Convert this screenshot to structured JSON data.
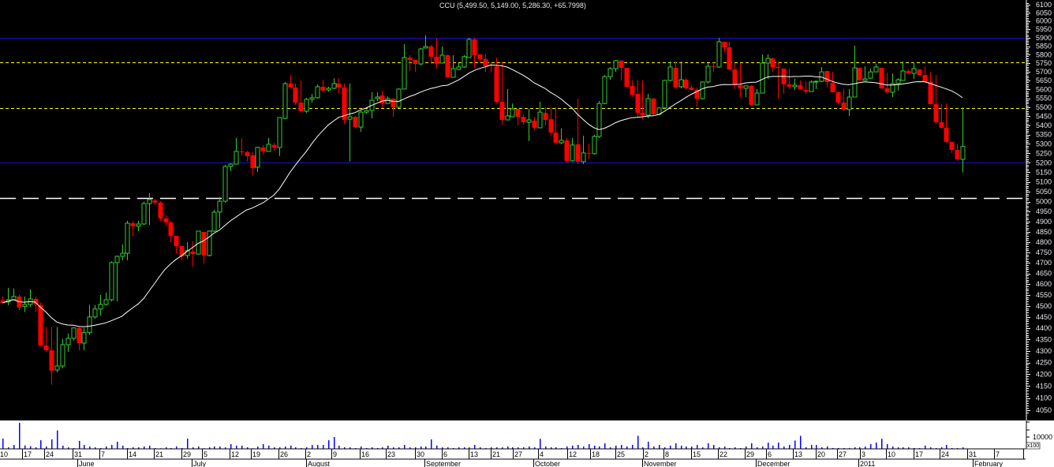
{
  "chart_data": {
    "type": "candlestick",
    "title": "CCU (5,499.50, 5,149.00, 5,286.30, +65.7998)",
    "symbol": "CCU",
    "y_scale": "log",
    "ylim": [
      4030,
      6120
    ],
    "y_ticks": [
      4050,
      4100,
      4150,
      4200,
      4250,
      4300,
      4350,
      4400,
      4450,
      4500,
      4550,
      4600,
      4650,
      4700,
      4750,
      4800,
      4850,
      4900,
      4950,
      5000,
      5050,
      5100,
      5150,
      5200,
      5250,
      5300,
      5350,
      5400,
      5450,
      5500,
      5550,
      5600,
      5650,
      5700,
      5750,
      5800,
      5850,
      5900,
      5950,
      6000,
      6050,
      6100
    ],
    "moving_average": {
      "period": 20,
      "color": "#ffffff"
    },
    "colors": {
      "up": "#33cc33",
      "down": "#ff0000",
      "background": "#000000",
      "volume": "#0000ff",
      "support": "#0000cc",
      "trigger": "#ffff00"
    },
    "horizontal_lines": [
      {
        "value": 5900,
        "style": "solid",
        "color": "#1414c8"
      },
      {
        "value": 5755,
        "style": "dashed",
        "color": "#ffff00"
      },
      {
        "value": 5495,
        "style": "dashed",
        "color": "#ffff00"
      },
      {
        "value": 5200,
        "style": "solid",
        "color": "#1414c8"
      },
      {
        "value": 5020,
        "style": "longdash",
        "color": "#ffffff"
      }
    ],
    "ohlc": [
      [
        4525,
        4543,
        4510,
        4514
      ],
      [
        4518,
        4583,
        4503,
        4528
      ],
      [
        4528,
        4580,
        4525,
        4543
      ],
      [
        4543,
        4550,
        4482,
        4493
      ],
      [
        4497,
        4543,
        4472,
        4507
      ],
      [
        4507,
        4576,
        4496,
        4532
      ],
      [
        4532,
        4543,
        4472,
        4507
      ],
      [
        4504,
        4515,
        4320,
        4324
      ],
      [
        4324,
        4405,
        4296,
        4303
      ],
      [
        4303,
        4405,
        4156,
        4215
      ],
      [
        4218,
        4405,
        4208,
        4235
      ],
      [
        4235,
        4352,
        4225,
        4327
      ],
      [
        4327,
        4376,
        4296,
        4355
      ],
      [
        4355,
        4405,
        4345,
        4401
      ],
      [
        4401,
        4405,
        4303,
        4334
      ],
      [
        4334,
        4401,
        4303,
        4380
      ],
      [
        4380,
        4504,
        4370,
        4450
      ],
      [
        4450,
        4504,
        4443,
        4486
      ],
      [
        4486,
        4550,
        4457,
        4507
      ],
      [
        4507,
        4561,
        4500,
        4528
      ],
      [
        4528,
        4708,
        4521,
        4701
      ],
      [
        4701,
        4735,
        4521,
        4731
      ],
      [
        4731,
        4788,
        4712,
        4746
      ],
      [
        4746,
        4904,
        4712,
        4892
      ],
      [
        4892,
        4904,
        4830,
        4877
      ],
      [
        4877,
        4904,
        4853,
        4888
      ],
      [
        4888,
        5000,
        4884,
        4990
      ],
      [
        4990,
        5043,
        4884,
        5010
      ],
      [
        5006,
        5010,
        4983,
        4995
      ],
      [
        4995,
        5002,
        4904,
        4916
      ],
      [
        4916,
        4932,
        4880,
        4896
      ],
      [
        4896,
        4904,
        4799,
        4830
      ],
      [
        4830,
        4830,
        4746,
        4780
      ],
      [
        4780,
        4780,
        4712,
        4731
      ],
      [
        4735,
        4799,
        4720,
        4758
      ],
      [
        4754,
        4803,
        4682,
        4742
      ],
      [
        4742,
        4853,
        4739,
        4853
      ],
      [
        4849,
        4849,
        4697,
        4735
      ],
      [
        4735,
        4857,
        4731,
        4853
      ],
      [
        4853,
        4959,
        4849,
        4947
      ],
      [
        4947,
        5022,
        4869,
        5002
      ],
      [
        5002,
        5189,
        4995,
        5181
      ],
      [
        5181,
        5197,
        5156,
        5193
      ],
      [
        5193,
        5332,
        5193,
        5260
      ],
      [
        5260,
        5332,
        5239,
        5256
      ],
      [
        5256,
        5264,
        5206,
        5235
      ],
      [
        5239,
        5256,
        5135,
        5172
      ],
      [
        5177,
        5285,
        5152,
        5281
      ],
      [
        5281,
        5294,
        5243,
        5260
      ],
      [
        5260,
        5332,
        5260,
        5298
      ],
      [
        5294,
        5306,
        5264,
        5281
      ],
      [
        5281,
        5443,
        5235,
        5443
      ],
      [
        5438,
        5642,
        5434,
        5633
      ],
      [
        5633,
        5682,
        5606,
        5611
      ],
      [
        5611,
        5633,
        5513,
        5526
      ],
      [
        5526,
        5651,
        5469,
        5478
      ],
      [
        5478,
        5553,
        5469,
        5544
      ],
      [
        5544,
        5575,
        5526,
        5553
      ],
      [
        5553,
        5628,
        5548,
        5615
      ],
      [
        5615,
        5655,
        5584,
        5593
      ],
      [
        5597,
        5615,
        5588,
        5606
      ],
      [
        5606,
        5664,
        5602,
        5633
      ],
      [
        5633,
        5664,
        5579,
        5611
      ],
      [
        5611,
        5633,
        5408,
        5430
      ],
      [
        5434,
        5633,
        5206,
        5447
      ],
      [
        5447,
        5452,
        5383,
        5391
      ],
      [
        5391,
        5482,
        5365,
        5473
      ],
      [
        5473,
        5487,
        5465,
        5482
      ],
      [
        5482,
        5584,
        5439,
        5539
      ],
      [
        5548,
        5584,
        5535,
        5557
      ],
      [
        5566,
        5593,
        5496,
        5521
      ],
      [
        5521,
        5561,
        5521,
        5548
      ],
      [
        5548,
        5548,
        5447,
        5500
      ],
      [
        5500,
        5606,
        5496,
        5602
      ],
      [
        5602,
        5862,
        5602,
        5783
      ],
      [
        5783,
        5797,
        5705,
        5769
      ],
      [
        5769,
        5769,
        5700,
        5746
      ],
      [
        5746,
        5839,
        5737,
        5834
      ],
      [
        5839,
        5914,
        5839,
        5848
      ],
      [
        5848,
        5858,
        5746,
        5788
      ],
      [
        5788,
        5895,
        5719,
        5746
      ],
      [
        5751,
        5848,
        5751,
        5797
      ],
      [
        5797,
        5802,
        5664,
        5669
      ],
      [
        5669,
        5797,
        5669,
        5719
      ],
      [
        5714,
        5751,
        5710,
        5728
      ],
      [
        5728,
        5797,
        5723,
        5788
      ],
      [
        5783,
        5900,
        5783,
        5890
      ],
      [
        5890,
        5900,
        5723,
        5797
      ],
      [
        5802,
        5802,
        5751,
        5774
      ],
      [
        5774,
        5802,
        5700,
        5732
      ],
      [
        5741,
        5751,
        5700,
        5737
      ],
      [
        5732,
        5783,
        5521,
        5530
      ],
      [
        5530,
        5760,
        5404,
        5430
      ],
      [
        5430,
        5602,
        5430,
        5452
      ],
      [
        5447,
        5521,
        5447,
        5491
      ],
      [
        5491,
        5491,
        5400,
        5447
      ],
      [
        5447,
        5460,
        5404,
        5417
      ],
      [
        5417,
        5491,
        5315,
        5430
      ],
      [
        5426,
        5447,
        5374,
        5387
      ],
      [
        5387,
        5530,
        5387,
        5473
      ],
      [
        5469,
        5500,
        5400,
        5430
      ],
      [
        5434,
        5500,
        5344,
        5361
      ],
      [
        5361,
        5500,
        5306,
        5306
      ],
      [
        5306,
        5383,
        5298,
        5319
      ],
      [
        5319,
        5332,
        5202,
        5210
      ],
      [
        5210,
        5332,
        5206,
        5294
      ],
      [
        5298,
        5548,
        5193,
        5206
      ],
      [
        5206,
        5344,
        5193,
        5252
      ],
      [
        5252,
        5302,
        5218,
        5248
      ],
      [
        5248,
        5349,
        5243,
        5340
      ],
      [
        5340,
        5535,
        5332,
        5521
      ],
      [
        5521,
        5682,
        5517,
        5673
      ],
      [
        5673,
        5728,
        5655,
        5719
      ],
      [
        5719,
        5769,
        5700,
        5765
      ],
      [
        5765,
        5769,
        5651,
        5723
      ],
      [
        5723,
        5723,
        5611,
        5615
      ],
      [
        5620,
        5651,
        5557,
        5570
      ],
      [
        5575,
        5651,
        5447,
        5469
      ],
      [
        5469,
        5651,
        5434,
        5456
      ],
      [
        5456,
        5575,
        5439,
        5548
      ],
      [
        5548,
        5553,
        5456,
        5460
      ],
      [
        5460,
        5500,
        5456,
        5496
      ],
      [
        5496,
        5655,
        5496,
        5651
      ],
      [
        5651,
        5760,
        5646,
        5728
      ],
      [
        5723,
        5760,
        5602,
        5611
      ],
      [
        5615,
        5760,
        5606,
        5655
      ],
      [
        5655,
        5664,
        5597,
        5606
      ],
      [
        5611,
        5624,
        5593,
        5597
      ],
      [
        5597,
        5611,
        5504,
        5548
      ],
      [
        5548,
        5646,
        5544,
        5642
      ],
      [
        5642,
        5751,
        5633,
        5732
      ],
      [
        5732,
        5755,
        5700,
        5728
      ],
      [
        5728,
        5900,
        5723,
        5876
      ],
      [
        5876,
        5876,
        5815,
        5843
      ],
      [
        5843,
        5876,
        5710,
        5714
      ],
      [
        5714,
        5751,
        5602,
        5624
      ],
      [
        5624,
        5751,
        5557,
        5606
      ],
      [
        5606,
        5620,
        5557,
        5620
      ],
      [
        5620,
        5624,
        5509,
        5513
      ],
      [
        5513,
        5602,
        5513,
        5579
      ],
      [
        5579,
        5802,
        5579,
        5751
      ],
      [
        5751,
        5802,
        5660,
        5778
      ],
      [
        5778,
        5783,
        5700,
        5728
      ],
      [
        5728,
        5760,
        5548,
        5723
      ],
      [
        5719,
        5719,
        5575,
        5629
      ],
      [
        5629,
        5719,
        5602,
        5615
      ],
      [
        5615,
        5660,
        5597,
        5624
      ],
      [
        5624,
        5651,
        5602,
        5602
      ],
      [
        5597,
        5646,
        5575,
        5588
      ],
      [
        5588,
        5651,
        5588,
        5642
      ],
      [
        5642,
        5651,
        5602,
        5646
      ],
      [
        5646,
        5728,
        5642,
        5700
      ],
      [
        5705,
        5705,
        5611,
        5642
      ],
      [
        5637,
        5700,
        5584,
        5584
      ],
      [
        5584,
        5584,
        5517,
        5526
      ],
      [
        5526,
        5602,
        5478,
        5487
      ],
      [
        5487,
        5602,
        5452,
        5557
      ],
      [
        5557,
        5853,
        5557,
        5723
      ],
      [
        5723,
        5723,
        5651,
        5651
      ],
      [
        5651,
        5732,
        5651,
        5660
      ],
      [
        5664,
        5719,
        5660,
        5700
      ],
      [
        5700,
        5746,
        5700,
        5728
      ],
      [
        5723,
        5723,
        5602,
        5606
      ],
      [
        5606,
        5696,
        5575,
        5584
      ],
      [
        5584,
        5691,
        5557,
        5633
      ],
      [
        5633,
        5664,
        5593,
        5655
      ],
      [
        5651,
        5760,
        5651,
        5705
      ],
      [
        5705,
        5714,
        5691,
        5691
      ],
      [
        5691,
        5755,
        5660,
        5719
      ],
      [
        5714,
        5714,
        5682,
        5682
      ],
      [
        5682,
        5732,
        5642,
        5642
      ],
      [
        5642,
        5700,
        5517,
        5517
      ],
      [
        5517,
        5682,
        5408,
        5417
      ],
      [
        5417,
        5517,
        5383,
        5387
      ],
      [
        5387,
        5521,
        5306,
        5311
      ],
      [
        5311,
        5311,
        5252,
        5268
      ],
      [
        5268,
        5302,
        5210,
        5218
      ],
      [
        5218,
        5499.5,
        5149,
        5286.3
      ]
    ],
    "volume": [
      8700,
      1300,
      3300,
      22000,
      2900,
      2200,
      1300,
      7300,
      2000,
      8000,
      15600,
      2700,
      1300,
      600,
      6700,
      3300,
      2000,
      1300,
      700,
      2000,
      3300,
      6000,
      2700,
      700,
      1300,
      1300,
      2000,
      2700,
      700,
      500,
      1300,
      700,
      2000,
      700,
      8700,
      1300,
      2000,
      500,
      1300,
      2000,
      2000,
      1300,
      4000,
      2700,
      2700,
      1300,
      500,
      2000,
      4000,
      2700,
      1300,
      1300,
      2000,
      2700,
      1300,
      700,
      1300,
      3300,
      3300,
      3300,
      7300,
      10000,
      2700,
      1300,
      1300,
      700,
      2000,
      700,
      1300,
      700,
      1300,
      2700,
      1300,
      1300,
      3300,
      1300,
      1300,
      2000,
      2000,
      8000,
      2700,
      1300,
      1300,
      700,
      1300,
      1300,
      1300,
      3300,
      1300,
      700,
      1300,
      1300,
      1300,
      2000,
      1300,
      1300,
      1300,
      2000,
      1300,
      8500,
      2000,
      1300,
      1300,
      700,
      2000,
      2700,
      3300,
      2000,
      4000,
      2700,
      2000,
      4700,
      1300,
      2700,
      3300,
      2000,
      3300,
      11000,
      1300,
      6000,
      2000,
      3300,
      1300,
      2700,
      4700,
      2700,
      2000,
      2000,
      3300,
      1300,
      4700,
      3300,
      1300,
      2000,
      700,
      1300,
      700,
      2000,
      4700,
      1300,
      2000,
      5300,
      2700,
      5300,
      2000,
      3300,
      7000,
      11000,
      1300,
      3300,
      3300,
      1300,
      2000,
      700,
      700,
      700,
      700,
      1300,
      1300,
      2000,
      4000,
      5300,
      8500,
      4000,
      2000,
      1300,
      1300,
      1300,
      700,
      700,
      2700,
      1300,
      700,
      1300,
      3300,
      700,
      700,
      1300
    ],
    "volume_axis": {
      "tick_label": "10000",
      "multiplier_label": "x100",
      "tick_value": 10000
    },
    "x_day_labels": [
      "10",
      "17",
      "24",
      "31",
      "7",
      "14",
      "21",
      "29",
      "5",
      "12",
      "19",
      "26",
      "2",
      "9",
      "16",
      "23",
      "30",
      "6",
      "13",
      "21",
      "27",
      "4",
      "12",
      "18",
      "25",
      "2",
      "8",
      "15",
      "22",
      "29",
      "6",
      "13",
      "20",
      "27",
      "3",
      "10",
      "17",
      "24",
      "31",
      "7"
    ],
    "x_month_labels": [
      "June",
      "July",
      "August",
      "September",
      "October",
      "November",
      "December",
      "2011",
      "February"
    ]
  }
}
